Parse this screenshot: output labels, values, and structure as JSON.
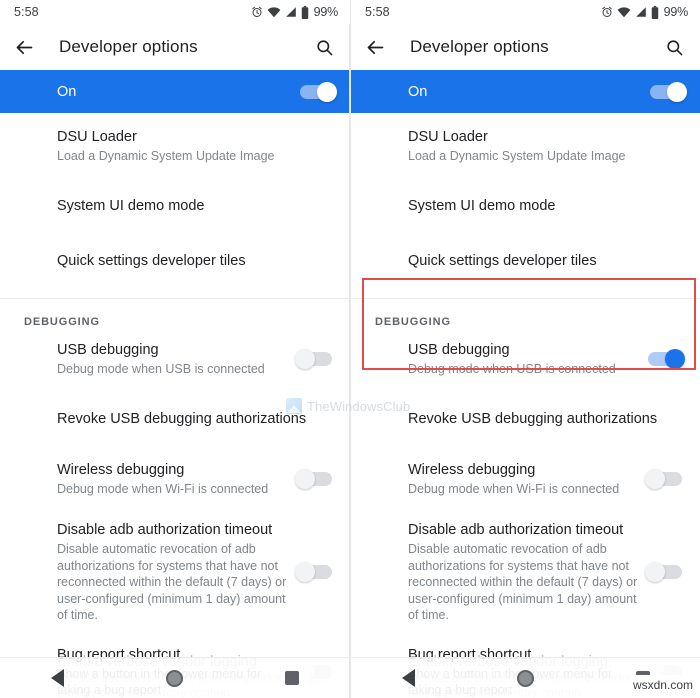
{
  "status_bar": {
    "time": "5:58",
    "battery_percent": "99%",
    "icons": [
      "alarm-icon",
      "wifi-icon",
      "signal-icon",
      "battery-icon"
    ]
  },
  "app_bar": {
    "back_icon": "back-arrow-icon",
    "title": "Developer options",
    "search_icon": "search-icon"
  },
  "master_switch": {
    "label": "On",
    "state": "on"
  },
  "colors": {
    "accent_blue": "#1a73e8",
    "banner_blue": "#1a73e8",
    "toggle_on_track": "#aecbfa",
    "toggle_off_track": "#dadce0",
    "highlight_red": "#e04b4b",
    "primary_text": "#202124",
    "secondary_text": "#80868b"
  },
  "top_items": [
    {
      "title": "DSU Loader",
      "subtitle": "Load a Dynamic System Update Image",
      "toggle": null
    },
    {
      "title": "System UI demo mode",
      "subtitle": "",
      "toggle": null
    },
    {
      "title": "Quick settings developer tiles",
      "subtitle": "",
      "toggle": null
    }
  ],
  "section": {
    "header": "DEBUGGING"
  },
  "debug_items_left": [
    {
      "title": "USB debugging",
      "subtitle": "Debug mode when USB is connected",
      "toggle": "off"
    },
    {
      "title": "Revoke USB debugging authorizations",
      "subtitle": "",
      "toggle": null
    },
    {
      "title": "Wireless debugging",
      "subtitle": "Debug mode when Wi-Fi is connected",
      "toggle": "off"
    },
    {
      "title": "Disable adb authorization timeout",
      "subtitle": "Disable automatic revocation of adb authorizations for systems that have not reconnected within the default (7 days) or user-configured (minimum 1 day) amount of time.",
      "toggle": "off"
    },
    {
      "title": "Bug report shortcut",
      "subtitle": "Show a button in the power menu for taking a bug report",
      "toggle": "off"
    }
  ],
  "debug_items_right": [
    {
      "title": "USB debugging",
      "subtitle": "Debug mode when USB is connected",
      "toggle": "on"
    },
    {
      "title": "Revoke USB debugging authorizations",
      "subtitle": "",
      "toggle": null
    },
    {
      "title": "Wireless debugging",
      "subtitle": "Debug mode when Wi-Fi is connected",
      "toggle": "off"
    },
    {
      "title": "Disable adb authorization timeout",
      "subtitle": "Disable automatic revocation of adb authorizations for systems that have not reconnected within the default (7 days) or user-configured (minimum 1 day) amount of time.",
      "toggle": "off"
    },
    {
      "title": "Bug report shortcut",
      "subtitle": "Show a button in the power menu for taking a bug report",
      "toggle": "off"
    }
  ],
  "faded_item": {
    "title": "Enable verbose vendor logging",
    "subtitle": "Include additional device-specific vendor logs in bug reports, which may contain"
  },
  "nav_bar": {
    "back": "nav-back-icon",
    "home": "nav-home-icon",
    "recents": "nav-recents-icon"
  },
  "watermarks": {
    "center": "TheWindowsClub",
    "bottom_right": "wsxdn.com"
  }
}
